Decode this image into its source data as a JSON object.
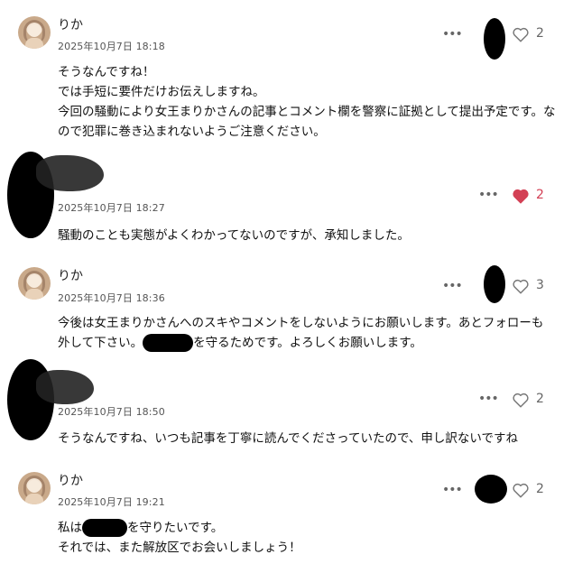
{
  "comments": [
    {
      "name": "りか",
      "date": "2025年10月7日 18:18",
      "lines": [
        "そうなんですね！",
        "では手短に要件だけお伝えしますね。",
        "今回の騒動により女王まりかさんの記事とコメント欄を警察に証拠として提出予定です。な",
        "ので犯罪に巻き込まれないようご注意ください。"
      ],
      "likes": "2",
      "liked": false,
      "more_icon": "ellipsis-icon",
      "heart_icon": "heart-outline-icon"
    },
    {
      "name": "",
      "date": "2025年10月7日 18:27",
      "lines": [
        "騒動のことも実態がよくわかってないのですが、承知しました。"
      ],
      "likes": "2",
      "liked": true,
      "more_icon": "ellipsis-icon",
      "heart_icon": "heart-filled-icon"
    },
    {
      "name": "りか",
      "date": "2025年10月7日 18:36",
      "lines_parts": [
        {
          "a": "今後は女王まりかさんへのスキやコメントをしないようにお願いします。あとフォローも",
          "b": ""
        },
        {
          "a": "外して下さい。",
          "b": "を守るためです。よろしくお願いします。"
        }
      ],
      "likes": "3",
      "liked": false,
      "more_icon": "ellipsis-icon",
      "heart_icon": "heart-outline-icon"
    },
    {
      "name": "",
      "date": "2025年10月7日 18:50",
      "lines": [
        "そうなんですね、いつも記事を丁寧に読んでくださっていたので、申し訳ないですね"
      ],
      "likes": "2",
      "liked": false,
      "more_icon": "ellipsis-icon",
      "heart_icon": "heart-outline-icon"
    },
    {
      "name": "りか",
      "date": "2025年10月7日 19:21",
      "lines_parts": [
        {
          "a": "私は",
          "b": "を守りたいです。"
        },
        {
          "a": "それでは、また解放区でお会いしましょう！",
          "b": ""
        }
      ],
      "likes": "2",
      "liked": false,
      "more_icon": "ellipsis-icon",
      "heart_icon": "heart-outline-icon"
    }
  ],
  "ui": {
    "more_label": "•••"
  },
  "colors": {
    "heart_liked": "#d34055",
    "heart_outline": "#777777",
    "meta": "#555555"
  }
}
